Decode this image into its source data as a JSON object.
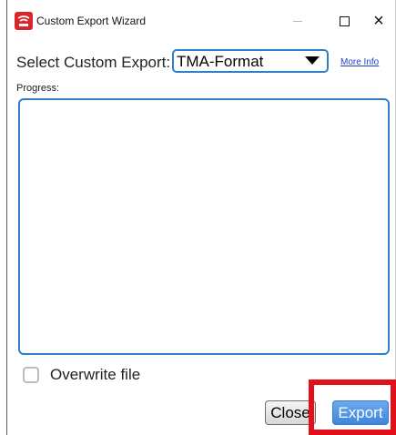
{
  "window": {
    "title": "Custom Export Wizard",
    "icon": "app-icon",
    "controls": {
      "minimize": "minimize-icon",
      "maximize": "maximize-icon",
      "close_glyph": "×"
    }
  },
  "export": {
    "select_label": "Select Custom Export:",
    "selected_value": "TMA-Format",
    "more_info": "More Info"
  },
  "progress": {
    "label": "Progress:",
    "text": ""
  },
  "options": {
    "overwrite_label": "Overwrite file",
    "overwrite_checked": false
  },
  "buttons": {
    "close_label": "Close",
    "export_label": "Export"
  },
  "colors": {
    "accent": "#2f7fc8",
    "highlight": "#e2101a",
    "brand_icon": "#d9262a"
  }
}
